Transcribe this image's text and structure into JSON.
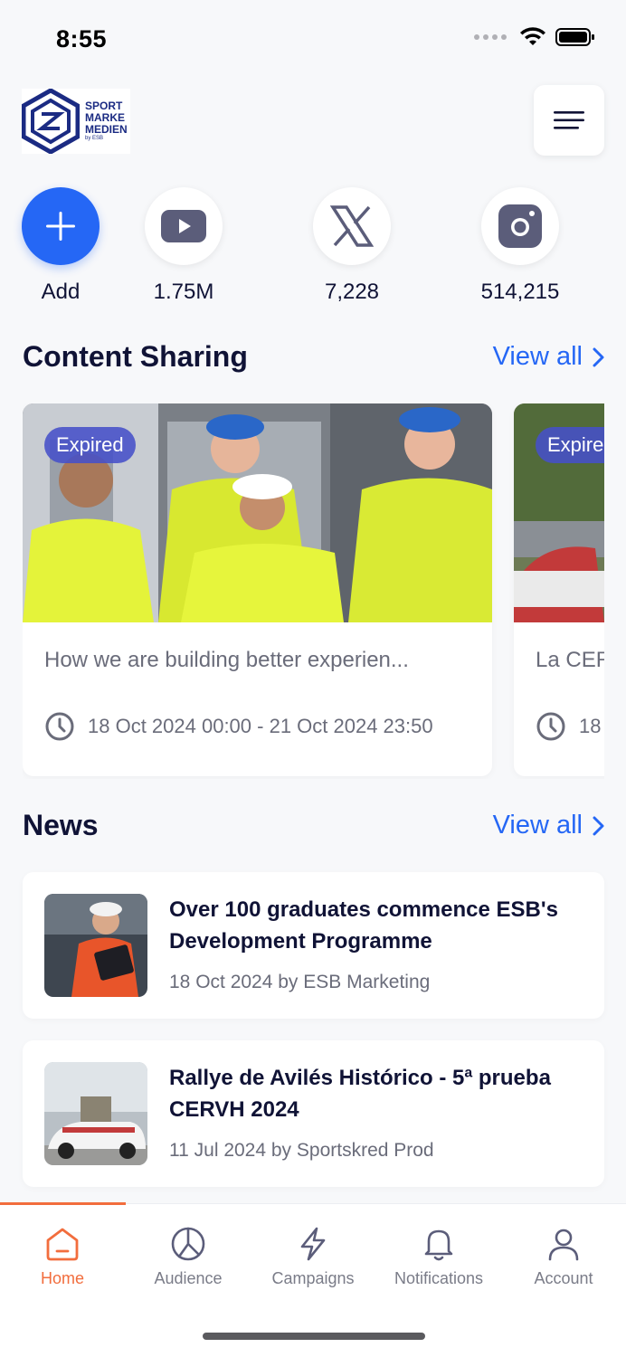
{
  "status_bar": {
    "time": "8:55"
  },
  "header": {
    "logo_lines": [
      "SPORT",
      "MARKE",
      "MEDIEN"
    ],
    "logo_sub": "by ESB"
  },
  "social": [
    {
      "label": "Add",
      "icon": "plus-icon"
    },
    {
      "label": "1.75M",
      "icon": "youtube-icon"
    },
    {
      "label": "7,228",
      "icon": "x-icon"
    },
    {
      "label": "514,215",
      "icon": "instagram-icon"
    }
  ],
  "content_sharing": {
    "title": "Content Sharing",
    "view_all": "View all",
    "cards": [
      {
        "badge": "Expired",
        "title": "How we are building better experien...",
        "date": "18 Oct 2024 00:00 - 21 Oct 2024 23:50"
      },
      {
        "badge": "Expired",
        "title": "La CERVH",
        "date": "18"
      }
    ]
  },
  "news": {
    "title": "News",
    "view_all": "View all",
    "items": [
      {
        "title": "Over 100 graduates commence ESB's Development Programme",
        "meta": "18 Oct 2024 by ESB Marketing"
      },
      {
        "title": "Rallye de Avilés Histórico - 5ª prueba CERVH 2024",
        "meta": "11 Jul 2024 by Sportskred Prod"
      }
    ]
  },
  "nav": {
    "items": [
      {
        "label": "Home",
        "icon": "home-icon",
        "active": true
      },
      {
        "label": "Audience",
        "icon": "pie-chart-icon",
        "active": false
      },
      {
        "label": "Campaigns",
        "icon": "lightning-icon",
        "active": false
      },
      {
        "label": "Notifications",
        "icon": "bell-icon",
        "active": false
      },
      {
        "label": "Account",
        "icon": "user-icon",
        "active": false
      }
    ],
    "active_color": "#f26d3d",
    "accent_color": "#2567f5"
  }
}
